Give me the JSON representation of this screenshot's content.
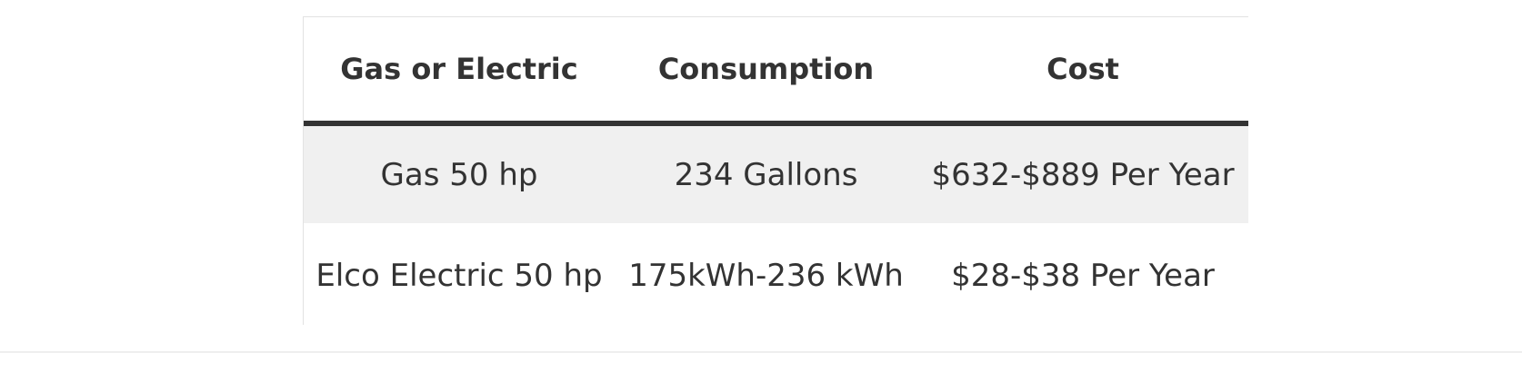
{
  "table": {
    "headers": [
      "Gas or Electric",
      "Consumption",
      "Cost"
    ],
    "rows": [
      [
        "Gas 50 hp",
        "234 Gallons",
        "$632-$889 Per Year"
      ],
      [
        "Elco Electric 50 hp",
        "175kWh-236 kWh",
        "$28-$38 Per Year"
      ]
    ]
  },
  "colors": {
    "text": "#333333",
    "header_rule": "#333333",
    "striped_row": "#f0f0f0",
    "border": "#e2e2e2"
  }
}
